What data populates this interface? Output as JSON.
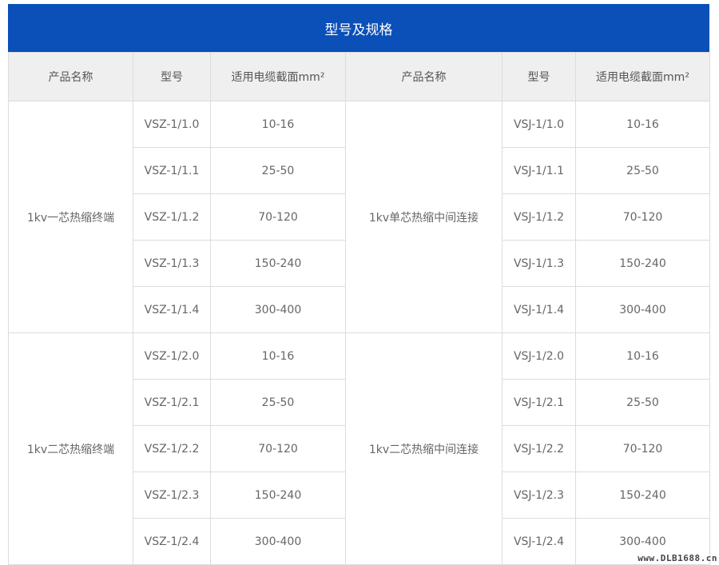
{
  "title": "型号及规格",
  "headers": [
    "产品名称",
    "型号",
    "适用电缆截面mm²",
    "产品名称",
    "型号",
    "适用电缆截面mm²"
  ],
  "groups": [
    {
      "left_name": "1kv一芯热缩终端",
      "right_name": "1kv单芯热缩中间连接",
      "rows": [
        {
          "left_model": "VSZ-1/1.0",
          "left_range": "10-16",
          "right_model": "VSJ-1/1.0",
          "right_range": "10-16"
        },
        {
          "left_model": "VSZ-1/1.1",
          "left_range": "25-50",
          "right_model": "VSJ-1/1.1",
          "right_range": "25-50"
        },
        {
          "left_model": "VSZ-1/1.2",
          "left_range": "70-120",
          "right_model": "VSJ-1/1.2",
          "right_range": "70-120"
        },
        {
          "left_model": "VSZ-1/1.3",
          "left_range": "150-240",
          "right_model": "VSJ-1/1.3",
          "right_range": "150-240"
        },
        {
          "left_model": "VSZ-1/1.4",
          "left_range": "300-400",
          "right_model": "VSJ-1/1.4",
          "right_range": "300-400"
        }
      ]
    },
    {
      "left_name": "1kv二芯热缩终端",
      "right_name": "1kv二芯热缩中间连接",
      "rows": [
        {
          "left_model": "VSZ-1/2.0",
          "left_range": "10-16",
          "right_model": "VSJ-1/2.0",
          "right_range": "10-16"
        },
        {
          "left_model": "VSZ-1/2.1",
          "left_range": "25-50",
          "right_model": "VSJ-1/2.1",
          "right_range": "25-50"
        },
        {
          "left_model": "VSZ-1/2.2",
          "left_range": "70-120",
          "right_model": "VSJ-1/2.2",
          "right_range": "70-120"
        },
        {
          "left_model": "VSZ-1/2.3",
          "left_range": "150-240",
          "right_model": "VSJ-1/2.3",
          "right_range": "150-240"
        },
        {
          "left_model": "VSZ-1/2.4",
          "left_range": "300-400",
          "right_model": "VSJ-1/2.4",
          "right_range": "300-400"
        }
      ]
    }
  ],
  "watermark": "www.DLB1688.cn",
  "colors": {
    "title_bg": "#0b4fb8",
    "header_bg": "#efefef",
    "border": "#dcdcdc"
  }
}
